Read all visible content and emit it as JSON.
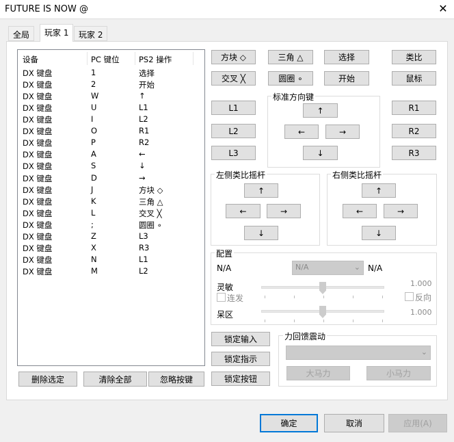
{
  "window": {
    "title": "FUTURE IS NOW @",
    "close": "✕"
  },
  "tabs": [
    "全局",
    "玩家 1",
    "玩家 2"
  ],
  "list": {
    "headers": [
      "设备",
      "PC 键位",
      "PS2 操作"
    ],
    "rows": [
      [
        "DX 键盘",
        "1",
        "选择"
      ],
      [
        "DX 键盘",
        "2",
        "开始"
      ],
      [
        "DX 键盘",
        "W",
        "↑"
      ],
      [
        "DX 键盘",
        "U",
        "L1"
      ],
      [
        "DX 键盘",
        "I",
        "L2"
      ],
      [
        "DX 键盘",
        "O",
        "R1"
      ],
      [
        "DX 键盘",
        "P",
        "R2"
      ],
      [
        "DX 键盘",
        "A",
        "←"
      ],
      [
        "DX 键盘",
        "S",
        "↓"
      ],
      [
        "DX 键盘",
        "D",
        "→"
      ],
      [
        "DX 键盘",
        "J",
        "方块 ◇"
      ],
      [
        "DX 键盘",
        "K",
        "三角 △"
      ],
      [
        "DX 键盘",
        "L",
        "交叉 ╳"
      ],
      [
        "DX 键盘",
        ";",
        "圆圈 ∘"
      ],
      [
        "DX 键盘",
        "Z",
        "L3"
      ],
      [
        "DX 键盘",
        "X",
        "R3"
      ],
      [
        "DX 键盘",
        "N",
        "L1"
      ],
      [
        "DX 键盘",
        "M",
        "L2"
      ]
    ]
  },
  "list_buttons": [
    "删除选定",
    "清除全部",
    "忽略按键"
  ],
  "pad": {
    "square": "方块 ◇",
    "triangle": "三角 △",
    "select": "选择",
    "analog": "类比",
    "cross": "交叉 ╳",
    "circle": "圆圈 ∘",
    "start": "开始",
    "mouse": "鼠标",
    "l1": "L1",
    "l2": "L2",
    "l3": "L3",
    "r1": "R1",
    "r2": "R2",
    "r3": "R3"
  },
  "dpad": {
    "label": "标准方向键",
    "up": "↑",
    "left": "←",
    "right": "→",
    "down": "↓"
  },
  "left_stick": {
    "label": "左侧类比摇杆",
    "up": "↑",
    "left": "←",
    "right": "→",
    "down": "↓"
  },
  "right_stick": {
    "label": "右侧类比摇杆",
    "up": "↑",
    "left": "←",
    "right": "→",
    "down": "↓"
  },
  "config": {
    "label": "配置",
    "left_value": "N/A",
    "combo_value": "N/A",
    "right_value": "N/A",
    "sensitivity_label": "灵敏",
    "sensitivity_value": "1.000",
    "sensitivity_level": 0.5,
    "turbo_label": "连发",
    "turbo_checked": false,
    "reverse_label": "反向",
    "reverse_checked": false,
    "deadzone_label": "呆区",
    "deadzone_value": "1.000",
    "deadzone_level": 0.5
  },
  "lock_buttons": [
    "锁定输入",
    "锁定指示",
    "锁定按钮"
  ],
  "force_feedback": {
    "label": "力回馈震动",
    "combo_value": "",
    "big_motor": "大马力",
    "small_motor": "小马力"
  },
  "footer": {
    "ok": "确定",
    "cancel": "取消",
    "apply": "应用(A)"
  }
}
